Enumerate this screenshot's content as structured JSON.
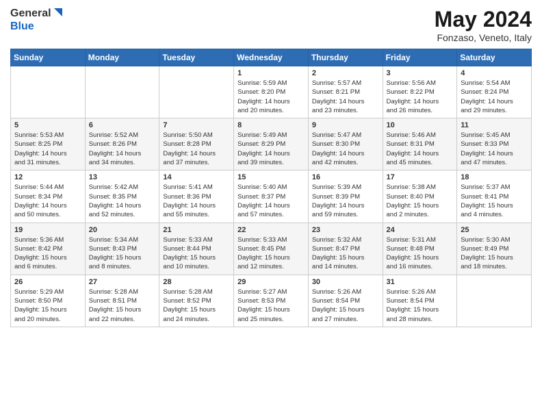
{
  "logo": {
    "general": "General",
    "blue": "Blue"
  },
  "header": {
    "month": "May 2024",
    "location": "Fonzaso, Veneto, Italy"
  },
  "weekdays": [
    "Sunday",
    "Monday",
    "Tuesday",
    "Wednesday",
    "Thursday",
    "Friday",
    "Saturday"
  ],
  "weeks": [
    [
      {
        "day": "",
        "info": ""
      },
      {
        "day": "",
        "info": ""
      },
      {
        "day": "",
        "info": ""
      },
      {
        "day": "1",
        "info": "Sunrise: 5:59 AM\nSunset: 8:20 PM\nDaylight: 14 hours\nand 20 minutes."
      },
      {
        "day": "2",
        "info": "Sunrise: 5:57 AM\nSunset: 8:21 PM\nDaylight: 14 hours\nand 23 minutes."
      },
      {
        "day": "3",
        "info": "Sunrise: 5:56 AM\nSunset: 8:22 PM\nDaylight: 14 hours\nand 26 minutes."
      },
      {
        "day": "4",
        "info": "Sunrise: 5:54 AM\nSunset: 8:24 PM\nDaylight: 14 hours\nand 29 minutes."
      }
    ],
    [
      {
        "day": "5",
        "info": "Sunrise: 5:53 AM\nSunset: 8:25 PM\nDaylight: 14 hours\nand 31 minutes."
      },
      {
        "day": "6",
        "info": "Sunrise: 5:52 AM\nSunset: 8:26 PM\nDaylight: 14 hours\nand 34 minutes."
      },
      {
        "day": "7",
        "info": "Sunrise: 5:50 AM\nSunset: 8:28 PM\nDaylight: 14 hours\nand 37 minutes."
      },
      {
        "day": "8",
        "info": "Sunrise: 5:49 AM\nSunset: 8:29 PM\nDaylight: 14 hours\nand 39 minutes."
      },
      {
        "day": "9",
        "info": "Sunrise: 5:47 AM\nSunset: 8:30 PM\nDaylight: 14 hours\nand 42 minutes."
      },
      {
        "day": "10",
        "info": "Sunrise: 5:46 AM\nSunset: 8:31 PM\nDaylight: 14 hours\nand 45 minutes."
      },
      {
        "day": "11",
        "info": "Sunrise: 5:45 AM\nSunset: 8:33 PM\nDaylight: 14 hours\nand 47 minutes."
      }
    ],
    [
      {
        "day": "12",
        "info": "Sunrise: 5:44 AM\nSunset: 8:34 PM\nDaylight: 14 hours\nand 50 minutes."
      },
      {
        "day": "13",
        "info": "Sunrise: 5:42 AM\nSunset: 8:35 PM\nDaylight: 14 hours\nand 52 minutes."
      },
      {
        "day": "14",
        "info": "Sunrise: 5:41 AM\nSunset: 8:36 PM\nDaylight: 14 hours\nand 55 minutes."
      },
      {
        "day": "15",
        "info": "Sunrise: 5:40 AM\nSunset: 8:37 PM\nDaylight: 14 hours\nand 57 minutes."
      },
      {
        "day": "16",
        "info": "Sunrise: 5:39 AM\nSunset: 8:39 PM\nDaylight: 14 hours\nand 59 minutes."
      },
      {
        "day": "17",
        "info": "Sunrise: 5:38 AM\nSunset: 8:40 PM\nDaylight: 15 hours\nand 2 minutes."
      },
      {
        "day": "18",
        "info": "Sunrise: 5:37 AM\nSunset: 8:41 PM\nDaylight: 15 hours\nand 4 minutes."
      }
    ],
    [
      {
        "day": "19",
        "info": "Sunrise: 5:36 AM\nSunset: 8:42 PM\nDaylight: 15 hours\nand 6 minutes."
      },
      {
        "day": "20",
        "info": "Sunrise: 5:34 AM\nSunset: 8:43 PM\nDaylight: 15 hours\nand 8 minutes."
      },
      {
        "day": "21",
        "info": "Sunrise: 5:33 AM\nSunset: 8:44 PM\nDaylight: 15 hours\nand 10 minutes."
      },
      {
        "day": "22",
        "info": "Sunrise: 5:33 AM\nSunset: 8:45 PM\nDaylight: 15 hours\nand 12 minutes."
      },
      {
        "day": "23",
        "info": "Sunrise: 5:32 AM\nSunset: 8:47 PM\nDaylight: 15 hours\nand 14 minutes."
      },
      {
        "day": "24",
        "info": "Sunrise: 5:31 AM\nSunset: 8:48 PM\nDaylight: 15 hours\nand 16 minutes."
      },
      {
        "day": "25",
        "info": "Sunrise: 5:30 AM\nSunset: 8:49 PM\nDaylight: 15 hours\nand 18 minutes."
      }
    ],
    [
      {
        "day": "26",
        "info": "Sunrise: 5:29 AM\nSunset: 8:50 PM\nDaylight: 15 hours\nand 20 minutes."
      },
      {
        "day": "27",
        "info": "Sunrise: 5:28 AM\nSunset: 8:51 PM\nDaylight: 15 hours\nand 22 minutes."
      },
      {
        "day": "28",
        "info": "Sunrise: 5:28 AM\nSunset: 8:52 PM\nDaylight: 15 hours\nand 24 minutes."
      },
      {
        "day": "29",
        "info": "Sunrise: 5:27 AM\nSunset: 8:53 PM\nDaylight: 15 hours\nand 25 minutes."
      },
      {
        "day": "30",
        "info": "Sunrise: 5:26 AM\nSunset: 8:54 PM\nDaylight: 15 hours\nand 27 minutes."
      },
      {
        "day": "31",
        "info": "Sunrise: 5:26 AM\nSunset: 8:54 PM\nDaylight: 15 hours\nand 28 minutes."
      },
      {
        "day": "",
        "info": ""
      }
    ]
  ]
}
